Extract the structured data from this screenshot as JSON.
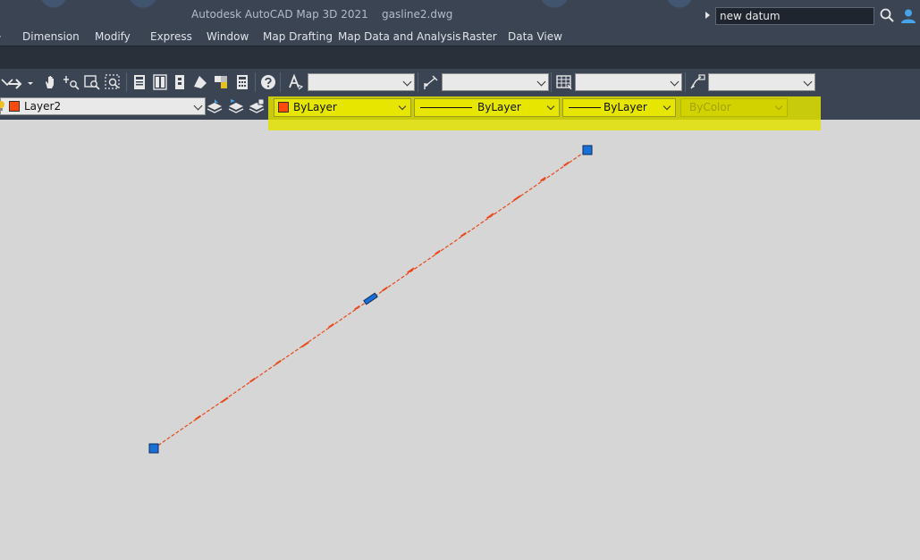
{
  "titlebar": {
    "title": "Autodesk AutoCAD Map 3D 2021    gasline2.dwg",
    "search_value": "new datum",
    "icons": [
      "search-icon",
      "user-icon"
    ]
  },
  "menu": {
    "items": [
      "Dimension",
      "Modify",
      "Express",
      "Window",
      "Map Drafting",
      "Map Data and Analysis",
      "Raster",
      "Data View"
    ]
  },
  "layer_toolbar": {
    "layer_name": "Layer2",
    "layer_color": "#ff4a0a"
  },
  "properties_toolbar": {
    "color_label": "ByLayer",
    "linetype_label": "ByLayer",
    "lineweight_label": "ByLayer",
    "plotstyle_label": "ByColor",
    "highlight_color": "#e2e200"
  },
  "drawing": {
    "line_color": "#e84a1a",
    "grip_color": "#1a6fd6"
  }
}
